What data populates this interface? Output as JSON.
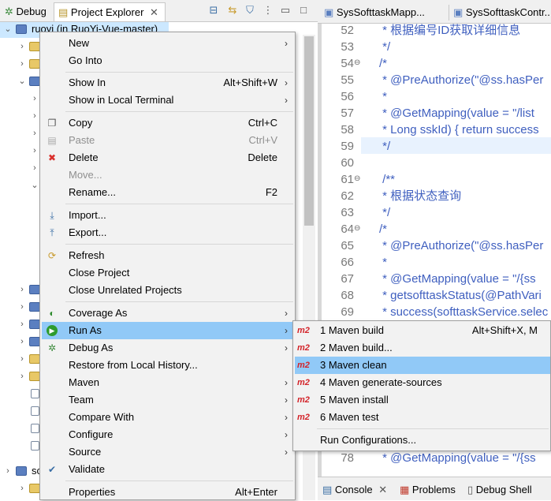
{
  "left_tabs": {
    "debug_label": "Debug",
    "project_explorer_label": "Project Explorer"
  },
  "tree": {
    "root_label": "ruoyi (in RuoYi-Vue-master)",
    "bottom_item_label": "sc"
  },
  "editor_tabs": {
    "tab1": "SysSofttaskMapp...",
    "tab2": "SysSofttaskContr..."
  },
  "editor": {
    "lines": [
      {
        "n": "52",
        "text": " * 根据编号ID获取详细信息"
      },
      {
        "n": "53",
        "text": " */"
      },
      {
        "n": "54",
        "text": "/*"
      },
      {
        "n": "55",
        "text": " * @PreAuthorize(\"@ss.hasPer"
      },
      {
        "n": "56",
        "text": " *"
      },
      {
        "n": "57",
        "text": " * @GetMapping(value = \"/list"
      },
      {
        "n": "58",
        "text": " * Long sskId) { return success"
      },
      {
        "n": "59",
        "text": " */"
      },
      {
        "n": "60",
        "text": ""
      },
      {
        "n": "61",
        "text": " /**"
      },
      {
        "n": "62",
        "text": " * 根据状态查询"
      },
      {
        "n": "63",
        "text": " */"
      },
      {
        "n": "64",
        "text": "/*"
      },
      {
        "n": "65",
        "text": " * @PreAuthorize(\"@ss.hasPer"
      },
      {
        "n": "66",
        "text": " *"
      },
      {
        "n": "67",
        "text": " * @GetMapping(value = \"/{ss"
      },
      {
        "n": "68",
        "text": " * getsofttaskStatus(@PathVari"
      },
      {
        "n": "69",
        "text": " * success(softtaskService.selec"
      },
      {
        "n": "78",
        "text": " * @GetMapping(value = \"/{ss"
      }
    ]
  },
  "console_bar": {
    "console_label": "Console",
    "problems_label": "Problems",
    "debug_shell_label": "Debug Shell"
  },
  "context_menu": {
    "items": [
      {
        "label": "New",
        "shortcut": "",
        "submenu": true
      },
      {
        "label": "Go Into",
        "shortcut": "",
        "submenu": false
      },
      {
        "label": "Show In",
        "shortcut": "Alt+Shift+W",
        "submenu": true
      },
      {
        "label": "Show in Local Terminal",
        "shortcut": "",
        "submenu": true
      },
      {
        "label": "Copy",
        "shortcut": "Ctrl+C",
        "submenu": false
      },
      {
        "label": "Paste",
        "shortcut": "Ctrl+V",
        "submenu": false
      },
      {
        "label": "Delete",
        "shortcut": "Delete",
        "submenu": false
      },
      {
        "label": "Move...",
        "shortcut": "",
        "submenu": false
      },
      {
        "label": "Rename...",
        "shortcut": "F2",
        "submenu": false
      },
      {
        "label": "Import...",
        "shortcut": "",
        "submenu": false
      },
      {
        "label": "Export...",
        "shortcut": "",
        "submenu": false
      },
      {
        "label": "Refresh",
        "shortcut": "",
        "submenu": false
      },
      {
        "label": "Close Project",
        "shortcut": "",
        "submenu": false
      },
      {
        "label": "Close Unrelated Projects",
        "shortcut": "",
        "submenu": false
      },
      {
        "label": "Coverage As",
        "shortcut": "",
        "submenu": true
      },
      {
        "label": "Run As",
        "shortcut": "",
        "submenu": true
      },
      {
        "label": "Debug As",
        "shortcut": "",
        "submenu": true
      },
      {
        "label": "Restore from Local History...",
        "shortcut": "",
        "submenu": false
      },
      {
        "label": "Maven",
        "shortcut": "",
        "submenu": true
      },
      {
        "label": "Team",
        "shortcut": "",
        "submenu": true
      },
      {
        "label": "Compare With",
        "shortcut": "",
        "submenu": true
      },
      {
        "label": "Configure",
        "shortcut": "",
        "submenu": true
      },
      {
        "label": "Source",
        "shortcut": "",
        "submenu": true
      },
      {
        "label": "Validate",
        "shortcut": "",
        "submenu": false
      },
      {
        "label": "Properties",
        "shortcut": "Alt+Enter",
        "submenu": false
      }
    ]
  },
  "run_as_submenu": {
    "badge": "m2",
    "items": [
      {
        "label": "1 Maven build",
        "shortcut": "Alt+Shift+X, M"
      },
      {
        "label": "2 Maven build...",
        "shortcut": ""
      },
      {
        "label": "3 Maven clean",
        "shortcut": ""
      },
      {
        "label": "4 Maven generate-sources",
        "shortcut": ""
      },
      {
        "label": "5 Maven install",
        "shortcut": ""
      },
      {
        "label": "6 Maven test",
        "shortcut": ""
      }
    ],
    "run_configurations_label": "Run Configurations..."
  },
  "colors": {
    "menu_highlight": "#91c9f7",
    "tree_selection": "#cce8ff",
    "comment_blue": "#3f5fbf",
    "m2_red": "#d3252b"
  }
}
